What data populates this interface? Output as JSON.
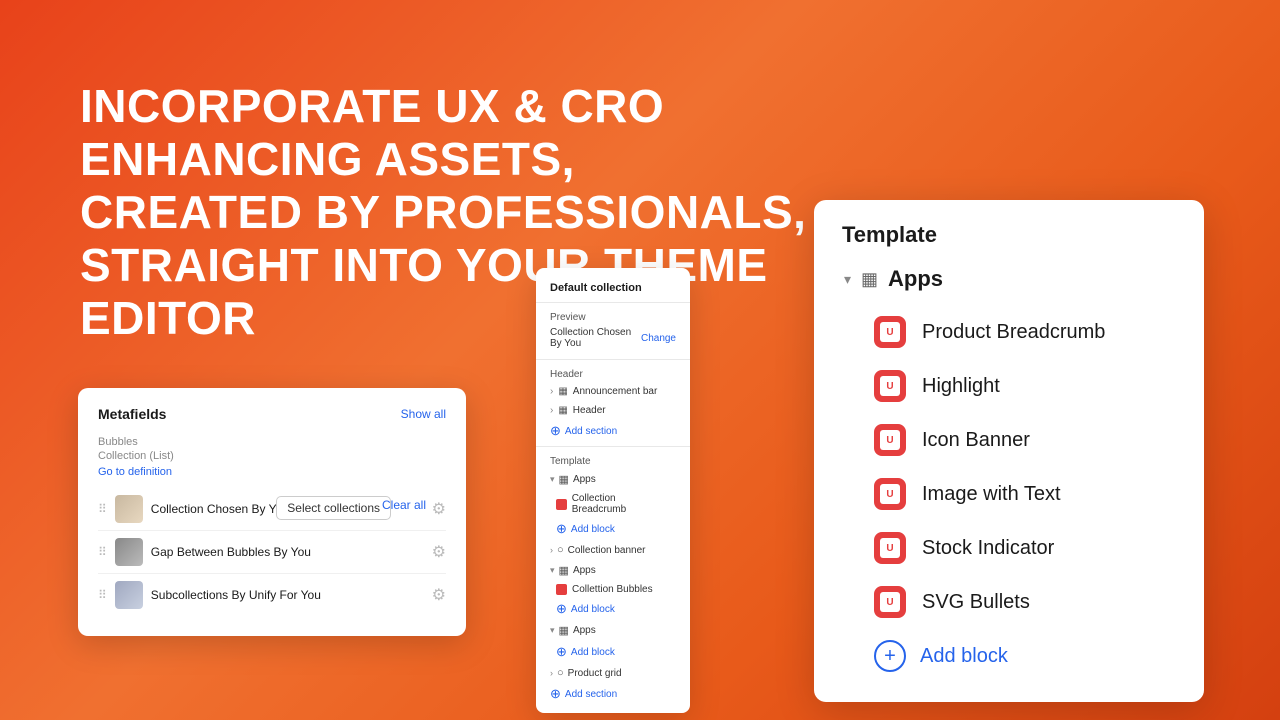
{
  "page": {
    "background": "gradient-orange-red"
  },
  "headline": {
    "line1": "INCORPORATE UX & CRO ENHANCING ASSETS,",
    "line2": "CREATED BY PROFESSIONALS,",
    "line3": "STRAIGHT INTO YOUR THEME EDITOR"
  },
  "metafields": {
    "title": "Metafields",
    "show_all": "Show all",
    "field_name": "Bubbles",
    "field_type": "Collection (List)",
    "go_to_def": "Go to definition",
    "select_btn": "Select collections",
    "clear_btn": "Clear all",
    "items": [
      {
        "name": "Collection Chosen By You"
      },
      {
        "name": "Gap Between Bubbles By You"
      },
      {
        "name": "Subcollections By Unify For You"
      }
    ]
  },
  "middle_panel": {
    "title": "Default collection",
    "preview_label": "Preview",
    "preview_value": "Collection Chosen By You",
    "change_link": "Change",
    "header_label": "Header",
    "announcement_bar": "Announcement bar",
    "header": "Header",
    "add_section": "Add section",
    "template_label": "Template",
    "apps_items": [
      {
        "label": "Apps",
        "sub": [
          {
            "name": "Collection Breadcrumb"
          },
          {
            "name": "Add block"
          }
        ]
      },
      {
        "label": "Collection banner"
      },
      {
        "label": "Apps",
        "sub": [
          {
            "name": "Collettion Bubbles"
          },
          {
            "name": "Add block"
          }
        ]
      },
      {
        "label": "Apps",
        "sub": [
          {
            "name": "Add block"
          }
        ]
      }
    ],
    "product_grid": "Product grid",
    "add_section2": "Add section"
  },
  "right_panel": {
    "title": "Template",
    "apps_label": "Apps",
    "items": [
      {
        "label": "Product Breadcrumb"
      },
      {
        "label": "Highlight"
      },
      {
        "label": "Icon Banner"
      },
      {
        "label": "Image with Text"
      },
      {
        "label": "Stock Indicator"
      },
      {
        "label": "SVG Bullets"
      }
    ],
    "add_block_label": "Add block"
  }
}
